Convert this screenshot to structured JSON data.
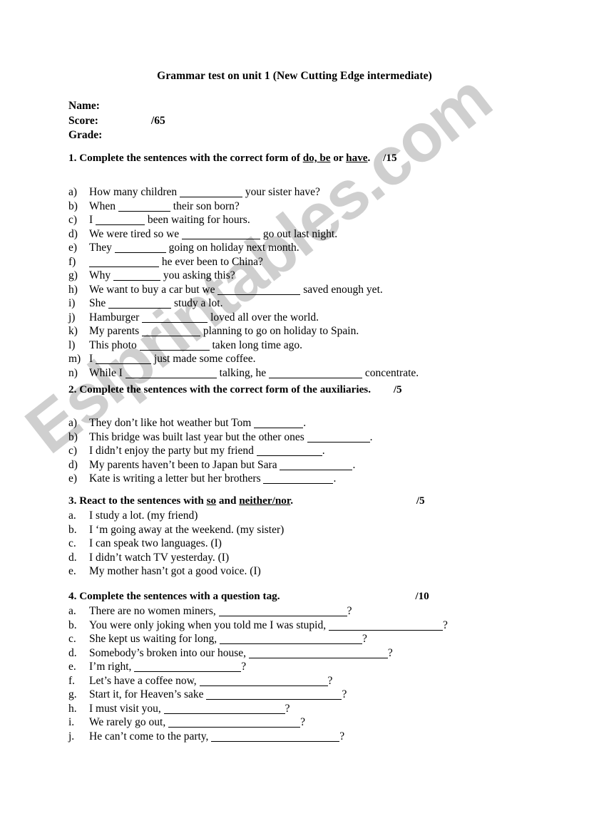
{
  "watermark": {
    "text": "Eslprintables.com",
    "color": "#cfcfcf"
  },
  "document": {
    "title": "Grammar test on unit 1 (New Cutting Edge intermediate)",
    "fields": {
      "name_label": "Name:",
      "score_label": "Score:",
      "score_value": "/65",
      "grade_label": "Grade:"
    }
  },
  "sections": [
    {
      "number": "1.",
      "heading_before": "Complete the sentences with the correct form of",
      "underlined_1": "do, be",
      "between": "or",
      "underlined_2": "have",
      "heading_after": ".",
      "points": "/15",
      "items": [
        {
          "marker": "a)",
          "parts": [
            "How many children",
            "BLANK:88",
            "your sister have?"
          ]
        },
        {
          "marker": "b)",
          "parts": [
            "When",
            "BLANK:73",
            "their son born?"
          ]
        },
        {
          "marker": "c)",
          "parts": [
            "I",
            "BLANK:69",
            "been waiting for hours."
          ]
        },
        {
          "marker": "d)",
          "parts": [
            "We were tired so we",
            "BLANK:110",
            "go out last night."
          ]
        },
        {
          "marker": "e)",
          "parts": [
            "They",
            "BLANK:72",
            "going on holiday next month."
          ]
        },
        {
          "marker": "f)",
          "parts": [
            "",
            "BLANK:98",
            "he ever been to China?"
          ]
        },
        {
          "marker": "g)",
          "parts": [
            "Why",
            "BLANK:66",
            "you asking this?"
          ]
        },
        {
          "marker": "h)",
          "parts": [
            "We want to buy a car but we",
            "BLANK:116",
            "saved enough yet."
          ]
        },
        {
          "marker": "i)",
          "parts": [
            "She",
            "BLANK:88",
            "study a lot."
          ]
        },
        {
          "marker": "j)",
          "parts": [
            "Hamburger",
            "BLANK:92",
            "loved all over the world."
          ]
        },
        {
          "marker": "k)",
          "parts": [
            "My parents",
            "BLANK:82",
            "planning to go on holiday to Spain."
          ]
        },
        {
          "marker": "l)",
          "parts": [
            "This photo",
            "BLANK:98",
            "taken long time ago."
          ]
        },
        {
          "marker": "m)",
          "parts": [
            "I",
            "BLANK:78",
            "just made some coffee."
          ]
        },
        {
          "marker": "n)",
          "parts": [
            "While I",
            "BLANK:128",
            "talking, he",
            "BLANK:131",
            "concentrate."
          ]
        }
      ]
    },
    {
      "number": "2.",
      "heading_before": "Complete the sentences with the correct form of the auxiliaries.",
      "points": "/5",
      "items": [
        {
          "marker": "a)",
          "parts": [
            "They don’t like hot weather but Tom",
            "BLANK:69",
            "."
          ]
        },
        {
          "marker": "b)",
          "parts": [
            "This bridge was built last year but the other ones",
            "BLANK:88",
            "."
          ]
        },
        {
          "marker": "c)",
          "parts": [
            "I didn’t enjoy the party but my friend",
            "BLANK:92",
            "."
          ]
        },
        {
          "marker": "d)",
          "parts": [
            "My parents haven’t been to Japan but Sara",
            "BLANK:102",
            "."
          ]
        },
        {
          "marker": "e)",
          "parts": [
            "Kate is writing a letter but her brothers",
            "BLANK:98",
            "."
          ]
        }
      ]
    },
    {
      "number": "3.",
      "heading_before": "React to the sentences with",
      "underlined_1": "so",
      "between": "and",
      "underlined_2": "neither/nor",
      "heading_after": ".",
      "points": "/5",
      "items": [
        {
          "marker": "a.",
          "parts": [
            "I study a lot. (my friend)"
          ]
        },
        {
          "marker": "b.",
          "parts": [
            "I ‘m going away at the weekend. (my sister)"
          ]
        },
        {
          "marker": "c.",
          "parts": [
            "I can speak two languages. (I)"
          ]
        },
        {
          "marker": "d.",
          "parts": [
            "I didn’t watch TV yesterday. (I)"
          ]
        },
        {
          "marker": "e.",
          "parts": [
            "My mother hasn’t got a good voice. (I)"
          ]
        }
      ]
    },
    {
      "number": "4.",
      "heading_before": "Complete the sentences with a question tag.",
      "points": "/10",
      "items": [
        {
          "marker": "a.",
          "parts": [
            "There are no women miners,",
            "BLANK:180",
            "?"
          ]
        },
        {
          "marker": "b.",
          "parts": [
            "You were only joking when you told me I was stupid,",
            "BLANK:160",
            "?"
          ]
        },
        {
          "marker": "c.",
          "parts": [
            "She kept us waiting for long,",
            "BLANK:200",
            "?"
          ]
        },
        {
          "marker": "d.",
          "parts": [
            "Somebody’s broken into our house,",
            "BLANK:195",
            "?"
          ]
        },
        {
          "marker": "e.",
          "parts": [
            "I’m right,",
            "BLANK:150",
            "?"
          ]
        },
        {
          "marker": "f.",
          "parts": [
            "Let’s have a coffee now,",
            "BLANK:180",
            "?"
          ]
        },
        {
          "marker": "g.",
          "parts": [
            "Start it, for Heaven’s sake",
            "BLANK:190",
            "?"
          ]
        },
        {
          "marker": "h.",
          "parts": [
            "I must visit you,",
            "BLANK:170",
            "?"
          ]
        },
        {
          "marker": "i.",
          "parts": [
            "We rarely go out,",
            "BLANK:185",
            "?"
          ]
        },
        {
          "marker": "j.",
          "parts": [
            "He can’t come to the party,",
            "BLANK:180",
            "?"
          ]
        }
      ]
    }
  ]
}
